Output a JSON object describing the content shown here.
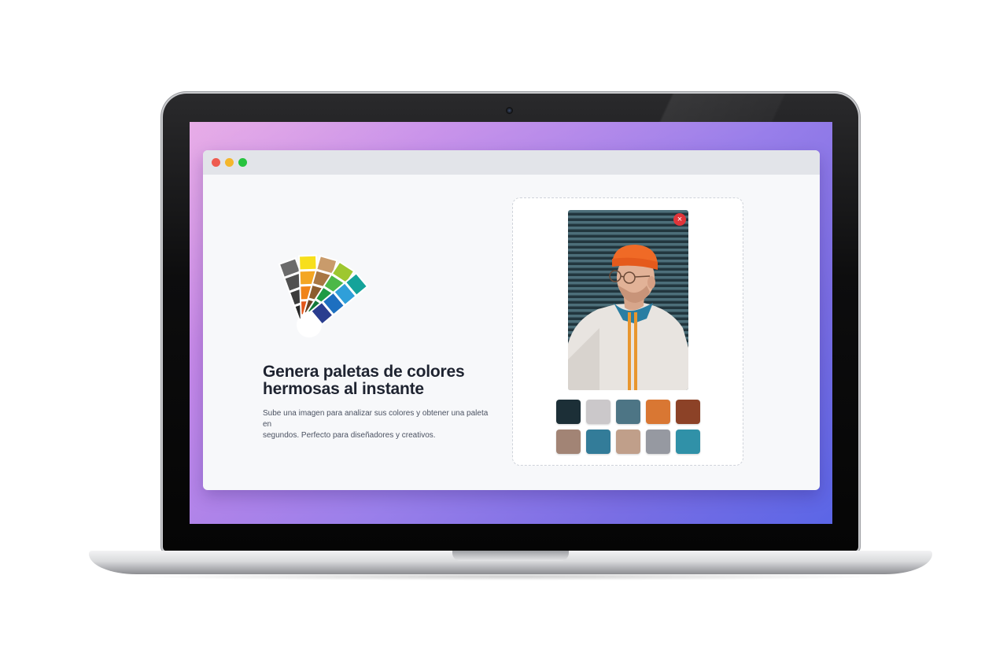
{
  "window": {
    "controls": [
      "close",
      "minimize",
      "maximize"
    ]
  },
  "hero": {
    "icon": "color-fan-icon",
    "title_line1": "Genera paletas de colores",
    "title_line2": "hermosas al instante",
    "subtitle_line1": "Sube una imagen para analizar sus colores y obtener una paleta en",
    "subtitle_line2": "segundos. Perfecto para diseñadores y creativos."
  },
  "upload": {
    "close_label": "×"
  },
  "palette": {
    "colors": [
      "#1c2f37",
      "#cbc8ca",
      "#4d7585",
      "#d97733",
      "#8c4227",
      "#a28475",
      "#337c99",
      "#c09f8a",
      "#9699a1",
      "#3091a8"
    ]
  }
}
